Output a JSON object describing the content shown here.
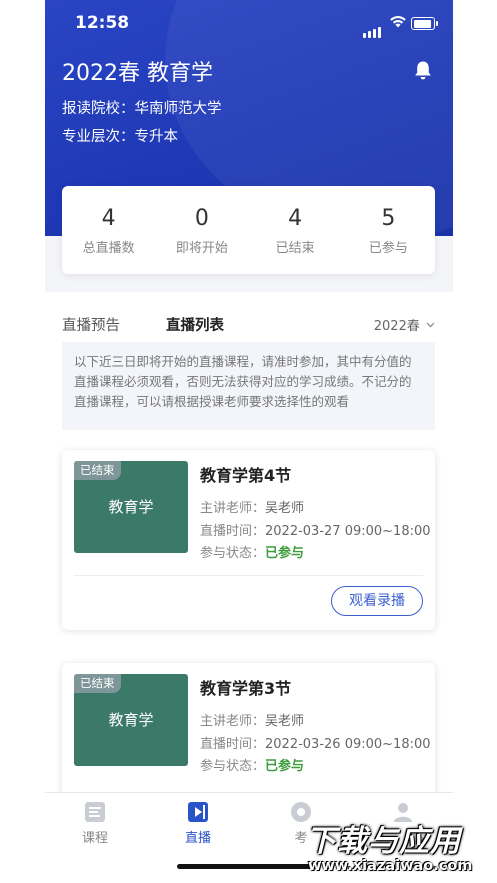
{
  "status_bar": {
    "time": "12:58"
  },
  "header": {
    "title": "2022春 教育学",
    "school": "报读院校：华南师范大学",
    "level": "专业层次：专升本"
  },
  "stats": [
    {
      "value": "4",
      "label": "总直播数"
    },
    {
      "value": "0",
      "label": "即将开始"
    },
    {
      "value": "4",
      "label": "已结束"
    },
    {
      "value": "5",
      "label": "已参与"
    }
  ],
  "tabs": [
    {
      "label": "直播预告",
      "active": false
    },
    {
      "label": "直播列表",
      "active": true
    }
  ],
  "term_select": "2022春",
  "notice": "以下近三日即将开始的直播课程，请准时参加，其中有分值的直播课程必须观看，否则无法获得对应的学习成绩。不记分的直播课程，可以请根据授课老师要求选择性的观看",
  "courses": [
    {
      "badge": "已结束",
      "thumb_text": "教育学",
      "title": "教育学第4节",
      "teacher_label": "主讲老师：",
      "teacher": "吴老师",
      "time_label": "直播时间：",
      "time": "2022-03-27 09:00~18:00",
      "status_label": "参与状态：",
      "status": "已参与",
      "action": "观看录播"
    },
    {
      "badge": "已结束",
      "thumb_text": "教育学",
      "title": "教育学第3节",
      "teacher_label": "主讲老师：",
      "teacher": "吴老师",
      "time_label": "直播时间：",
      "time": "2022-03-26 09:00~18:00",
      "status_label": "参与状态：",
      "status": "已参与"
    }
  ],
  "nav": [
    {
      "label": "课程",
      "icon": "course-icon"
    },
    {
      "label": "直播",
      "icon": "live-icon",
      "active": true
    },
    {
      "label": "考",
      "icon": "exam-icon"
    },
    {
      "label": "",
      "icon": "profile-icon"
    }
  ],
  "watermark": {
    "line1": "下载与应用",
    "line2": "www.xiazaiwao.com"
  },
  "colors": {
    "header_blue": "#1f39b6",
    "accent": "#3a5fcf",
    "success": "#3e9c3e",
    "thumb_green": "#3b7a69"
  }
}
